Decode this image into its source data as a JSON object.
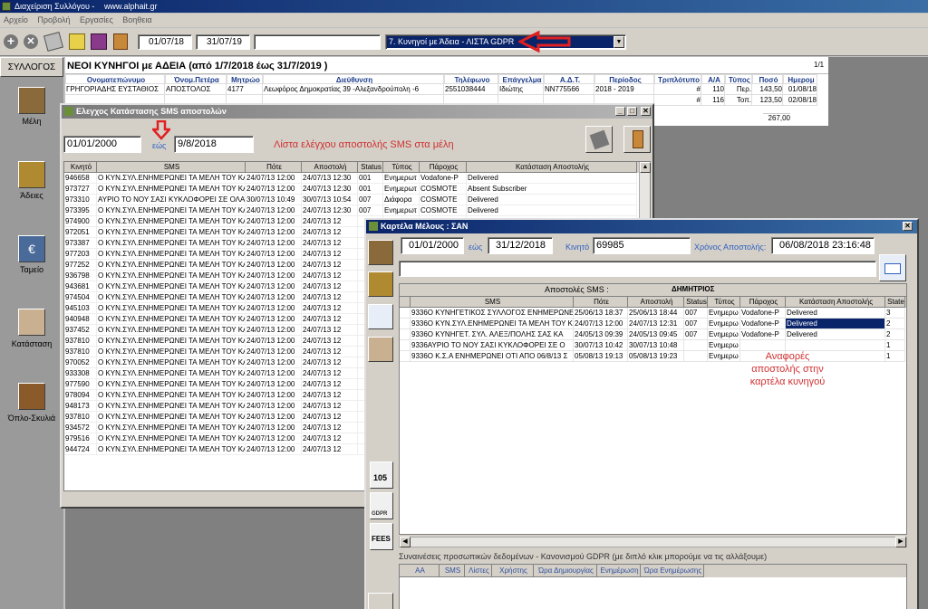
{
  "main_window": {
    "title": "Διαχείριση Συλλόγου -",
    "url": "www.alphait.gr"
  },
  "menu": [
    "Αρχείο",
    "Προβολή",
    "Εργασίες",
    "Βοηθεια"
  ],
  "toolbar": {
    "date_from": "01/07/18",
    "date_to": "31/07/19",
    "filter": "",
    "query": "7. Κυνηγοί με Άδεια - ΛΙΣΤΑ GDPR"
  },
  "side_nav": {
    "header": "ΣΥΛΛΟΓΟΣ",
    "items": [
      "Μέλη",
      "Άδειες",
      "Ταμείο",
      "Κατάσταση",
      "Όπλο-Σκυλιά"
    ]
  },
  "report": {
    "title": "ΝΕΟΙ ΚΥΝΗΓΟΙ με ΑΔΕΙΑ (από 1/7/2018 έως 31/7/2019 )",
    "page": "1/1",
    "columns": [
      "Ονοματεπώνυμο",
      "Όνομ.Πετέρα",
      "Μητρώο",
      "Διεύθυνση",
      "Τηλέφωνο",
      "Επάγγελμα",
      "Α.Δ.Τ.",
      "Περίοδος",
      "Τριπλότυπο",
      "Α/Α",
      "Τύπος",
      "Ποσό",
      "Ημερομ"
    ],
    "rows": [
      [
        "ΓΡΗΓΟΡΙΑΔΗΣ ΕΥΣΤΑΘΙΟΣ",
        "ΑΠΟΣΤΟΛΟΣ",
        "4177",
        "Λεωφόρος Δημοκρατίας 39 -Αλεξανδρούπολη -6",
        "2551038444",
        "Ιδιώτης",
        "NN775566",
        "2018 - 2019",
        "#",
        "110",
        "Περ.",
        "143,50",
        "01/08/18"
      ],
      [
        "",
        "",
        "",
        "",
        "",
        "",
        "",
        "",
        "#",
        "116",
        "Τοπ.",
        "123,50",
        "02/08/18"
      ]
    ],
    "total": "267,00"
  },
  "sms_window": {
    "title": "Ελεγχος Κατάστασης SMS αποστολών",
    "date_from": "01/01/2000",
    "to_label": "εώς",
    "date_to": "9/8/2018",
    "annotation": "Λίστα ελέγχου αποστολής SMS στα μέλη",
    "columns": [
      "Κινητό",
      "SMS",
      "Πότε",
      "Αποστολή",
      "Status",
      "Τύπος",
      "Πάροχος",
      "Κατάσταση Αποστολής"
    ],
    "rows": [
      [
        "946658",
        "Ο ΚΥΝ.ΣΥΛ.ΕΝΗΜΕΡΩΝΕΙ ΤΑ ΜΕΛΗ ΤΟΥ ΚΑΙ Σ",
        "24/07/13 12:00",
        "24/07/13 12:30",
        "001",
        "Ενημερωτ",
        "Vodafone-P",
        "Delivered"
      ],
      [
        "973727",
        "Ο ΚΥΝ.ΣΥΛ.ΕΝΗΜΕΡΩΝΕΙ ΤΑ ΜΕΛΗ ΤΟΥ ΚΑΙ Σ",
        "24/07/13 12:00",
        "24/07/13 12:30",
        "001",
        "Ενημερωτ",
        "COSMOTE",
        "Absent Subscriber"
      ],
      [
        "973310",
        "ΑΥΡΙΟ ΤΟ ΝΟΥ ΣΑΣΙ ΚΥΚΛΟΦΟΡΕΙ ΣΕ ΟΛΑ ΤΑ",
        "30/07/13 10:49",
        "30/07/13 10:54",
        "007",
        "Διάφορα",
        "COSMOTE",
        "Delivered"
      ],
      [
        "973395",
        "Ο ΚΥΝ.ΣΥΛ.ΕΝΗΜΕΡΩΝΕΙ ΤΑ ΜΕΛΗ ΤΟΥ ΚΑΙ Σ",
        "24/07/13 12:00",
        "24/07/13 12:30",
        "007",
        "Ενημερωτ",
        "COSMOTE",
        "Delivered"
      ],
      [
        "974900",
        "Ο ΚΥΝ.ΣΥΛ.ΕΝΗΜΕΡΩΝΕΙ ΤΑ ΜΕΛΗ ΤΟΥ ΚΑΙ Σ",
        "24/07/13 12:00",
        "24/07/13 12",
        "",
        "",
        "",
        ""
      ],
      [
        "972051",
        "Ο ΚΥΝ.ΣΥΛ.ΕΝΗΜΕΡΩΝΕΙ ΤΑ ΜΕΛΗ ΤΟΥ ΚΑΙ Σ",
        "24/07/13 12:00",
        "24/07/13 12",
        "",
        "",
        "",
        ""
      ],
      [
        "973387",
        "Ο ΚΥΝ.ΣΥΛ.ΕΝΗΜΕΡΩΝΕΙ ΤΑ ΜΕΛΗ ΤΟΥ ΚΑΙ Σ",
        "24/07/13 12:00",
        "24/07/13 12",
        "",
        "",
        "",
        ""
      ],
      [
        "977203",
        "Ο ΚΥΝ.ΣΥΛ.ΕΝΗΜΕΡΩΝΕΙ ΤΑ ΜΕΛΗ ΤΟΥ ΚΑΙ Σ",
        "24/07/13 12:00",
        "24/07/13 12",
        "",
        "",
        "",
        ""
      ],
      [
        "977252",
        "Ο ΚΥΝ.ΣΥΛ.ΕΝΗΜΕΡΩΝΕΙ ΤΑ ΜΕΛΗ ΤΟΥ ΚΑΙ Σ",
        "24/07/13 12:00",
        "24/07/13 12",
        "",
        "",
        "",
        ""
      ],
      [
        "936798",
        "Ο ΚΥΝ.ΣΥΛ.ΕΝΗΜΕΡΩΝΕΙ ΤΑ ΜΕΛΗ ΤΟΥ ΚΑΙ Σ",
        "24/07/13 12:00",
        "24/07/13 12",
        "",
        "",
        "",
        ""
      ],
      [
        "943681",
        "Ο ΚΥΝ.ΣΥΛ.ΕΝΗΜΕΡΩΝΕΙ ΤΑ ΜΕΛΗ ΤΟΥ ΚΑΙ Σ",
        "24/07/13 12:00",
        "24/07/13 12",
        "",
        "",
        "",
        ""
      ],
      [
        "974504",
        "Ο ΚΥΝ.ΣΥΛ.ΕΝΗΜΕΡΩΝΕΙ ΤΑ ΜΕΛΗ ΤΟΥ ΚΑΙ Σ",
        "24/07/13 12:00",
        "24/07/13 12",
        "",
        "",
        "",
        ""
      ],
      [
        "945103",
        "Ο ΚΥΝ.ΣΥΛ.ΕΝΗΜΕΡΩΝΕΙ ΤΑ ΜΕΛΗ ΤΟΥ ΚΑΙ Σ",
        "24/07/13 12:00",
        "24/07/13 12",
        "",
        "",
        "",
        ""
      ],
      [
        "940948",
        "Ο ΚΥΝ.ΣΥΛ.ΕΝΗΜΕΡΩΝΕΙ ΤΑ ΜΕΛΗ ΤΟΥ ΚΑΙ Σ",
        "24/07/13 12:00",
        "24/07/13 12",
        "",
        "",
        "",
        ""
      ],
      [
        "937452",
        "Ο ΚΥΝ.ΣΥΛ.ΕΝΗΜΕΡΩΝΕΙ ΤΑ ΜΕΛΗ ΤΟΥ ΚΑΙ Σ",
        "24/07/13 12:00",
        "24/07/13 12",
        "",
        "",
        "",
        ""
      ],
      [
        "937810",
        "Ο ΚΥΝ.ΣΥΛ.ΕΝΗΜΕΡΩΝΕΙ ΤΑ ΜΕΛΗ ΤΟΥ ΚΑΙ Σ",
        "24/07/13 12:00",
        "24/07/13 12",
        "",
        "",
        "",
        ""
      ],
      [
        "937810",
        "Ο ΚΥΝ.ΣΥΛ.ΕΝΗΜΕΡΩΝΕΙ ΤΑ ΜΕΛΗ ΤΟΥ ΚΑΙ Σ",
        "24/07/13 12:00",
        "24/07/13 12",
        "",
        "",
        "",
        ""
      ],
      [
        "970052",
        "Ο ΚΥΝ.ΣΥΛ.ΕΝΗΜΕΡΩΝΕΙ ΤΑ ΜΕΛΗ ΤΟΥ ΚΑΙ Σ",
        "24/07/13 12:00",
        "24/07/13 12",
        "",
        "",
        "",
        ""
      ],
      [
        "933308",
        "Ο ΚΥΝ.ΣΥΛ.ΕΝΗΜΕΡΩΝΕΙ ΤΑ ΜΕΛΗ ΤΟΥ ΚΑΙ Σ",
        "24/07/13 12:00",
        "24/07/13 12",
        "",
        "",
        "",
        ""
      ],
      [
        "977590",
        "Ο ΚΥΝ.ΣΥΛ.ΕΝΗΜΕΡΩΝΕΙ ΤΑ ΜΕΛΗ ΤΟΥ ΚΑΙ Σ",
        "24/07/13 12:00",
        "24/07/13 12",
        "",
        "",
        "",
        ""
      ],
      [
        "978094",
        "Ο ΚΥΝ.ΣΥΛ.ΕΝΗΜΕΡΩΝΕΙ ΤΑ ΜΕΛΗ ΤΟΥ ΚΑΙ Σ",
        "24/07/13 12:00",
        "24/07/13 12",
        "",
        "",
        "",
        ""
      ],
      [
        "948173",
        "Ο ΚΥΝ.ΣΥΛ.ΕΝΗΜΕΡΩΝΕΙ ΤΑ ΜΕΛΗ ΤΟΥ ΚΑΙ Σ",
        "24/07/13 12:00",
        "24/07/13 12",
        "",
        "",
        "",
        ""
      ],
      [
        "937810",
        "Ο ΚΥΝ.ΣΥΛ.ΕΝΗΜΕΡΩΝΕΙ ΤΑ ΜΕΛΗ ΤΟΥ ΚΑΙ Σ",
        "24/07/13 12:00",
        "24/07/13 12",
        "",
        "",
        "",
        ""
      ],
      [
        "934572",
        "Ο ΚΥΝ.ΣΥΛ.ΕΝΗΜΕΡΩΝΕΙ ΤΑ ΜΕΛΗ ΤΟΥ ΚΑΙ Σ",
        "24/07/13 12:00",
        "24/07/13 12",
        "",
        "",
        "",
        ""
      ],
      [
        "979516",
        "Ο ΚΥΝ.ΣΥΛ.ΕΝΗΜΕΡΩΝΕΙ ΤΑ ΜΕΛΗ ΤΟΥ ΚΑΙ Σ",
        "24/07/13 12:00",
        "24/07/13 12",
        "",
        "",
        "",
        ""
      ],
      [
        "944724",
        "Ο ΚΥΝ.ΣΥΛ.ΕΝΗΜΕΡΩΝΕΙ ΤΑ ΜΕΛΗ ΤΟΥ ΚΑΙ Σ",
        "24/07/13 12:00",
        "24/07/13 12",
        "",
        "",
        "",
        ""
      ]
    ]
  },
  "member_window": {
    "title": "Καρτέλα Μέλους : ΣΑΝ",
    "date_from": "01/01/2000",
    "to_label": "εώς",
    "date_to": "31/12/2018",
    "mobile_label": "Κινητό",
    "mobile": "69985",
    "send_time_label": "Χρόνος Αποστολής:",
    "send_time": "06/08/2018 23:16:48",
    "sms_header": "Αποστολές SMS :",
    "member_name": "ΔΗΜΗΤΡΙΟΣ",
    "columns": [
      "",
      "SMS",
      "Πότε",
      "Αποστολή",
      "Status",
      "Τύπος",
      "Πάροχος",
      "Κατάσταση Αποστολής",
      "State"
    ],
    "rows": [
      [
        "",
        "9336Ο ΚΥΝΗΓΕΤΙΚΟΣ ΣΥΛΛΟΓΟΣ ΕΝΗΜΕΡΩΝΕ",
        "25/06/13 18:37",
        "25/06/13 18:44",
        "007",
        "Ενημερω",
        "Vodafone-P",
        "Delivered",
        "3"
      ],
      [
        "",
        "9336Ο ΚΥΝ.ΣΥΛ.ΕΝΗΜΕΡΩΝΕΙ ΤΑ ΜΕΛΗ ΤΟΥ Κ",
        "24/07/13 12:00",
        "24/07/13 12:31",
        "007",
        "Ενημερω",
        "Vodafone-P",
        "Delivered",
        "2"
      ],
      [
        "",
        "9336Ο ΚΥΝΗΓΕΤ. ΣΥΛ. ΑΛΕΞ/ΠΟΛΗΣ ΣΑΣ ΚΑ",
        "24/05/13 09:39",
        "24/05/13 09:45",
        "007",
        "Ενημερω",
        "Vodafone-P",
        "Delivered",
        "2"
      ],
      [
        "",
        "9336ΑΥΡΙΟ ΤΟ ΝΟΥ ΣΑΣΙ ΚΥΚΛΟΦΟΡΕΙ ΣΕ Ο",
        "30/07/13 10:42",
        "30/07/13 10:48",
        "",
        "Ενημερω",
        "",
        "",
        "1"
      ],
      [
        "",
        "9336Ο Κ.Σ.Α ΕΝΗΜΕΡΩΝΕΙ ΟΤΙ ΑΠΟ 06/8/13 Σ",
        "05/08/13 19:13",
        "05/08/13 19:23",
        "",
        "Ενημερω",
        "",
        "",
        "1"
      ]
    ],
    "annotation": "Αναφορές αποστολής στην καρτέλα κυνηγού",
    "gdpr_label": "Συναινέσεις προσωπικών δεδομένων - Κανονισμού GDPR (με διπλό κλικ μπορούμε να τις αλλάξουμε)",
    "gdpr_columns": [
      "ΑΑ",
      "SMS",
      "Λίστες",
      "Χρήστης",
      "Ώρα Δημιουργίας",
      "Ενημέρωση",
      "Ώρα Ενημέρωσης"
    ]
  },
  "side_tools": {
    "num_label": "105",
    "gdpr_label": "GDPR",
    "fees_label": "FEES"
  },
  "colors": {
    "accent_red": "#d03030",
    "title_blue": "#0a246a",
    "select_blue": "#0a246a"
  }
}
